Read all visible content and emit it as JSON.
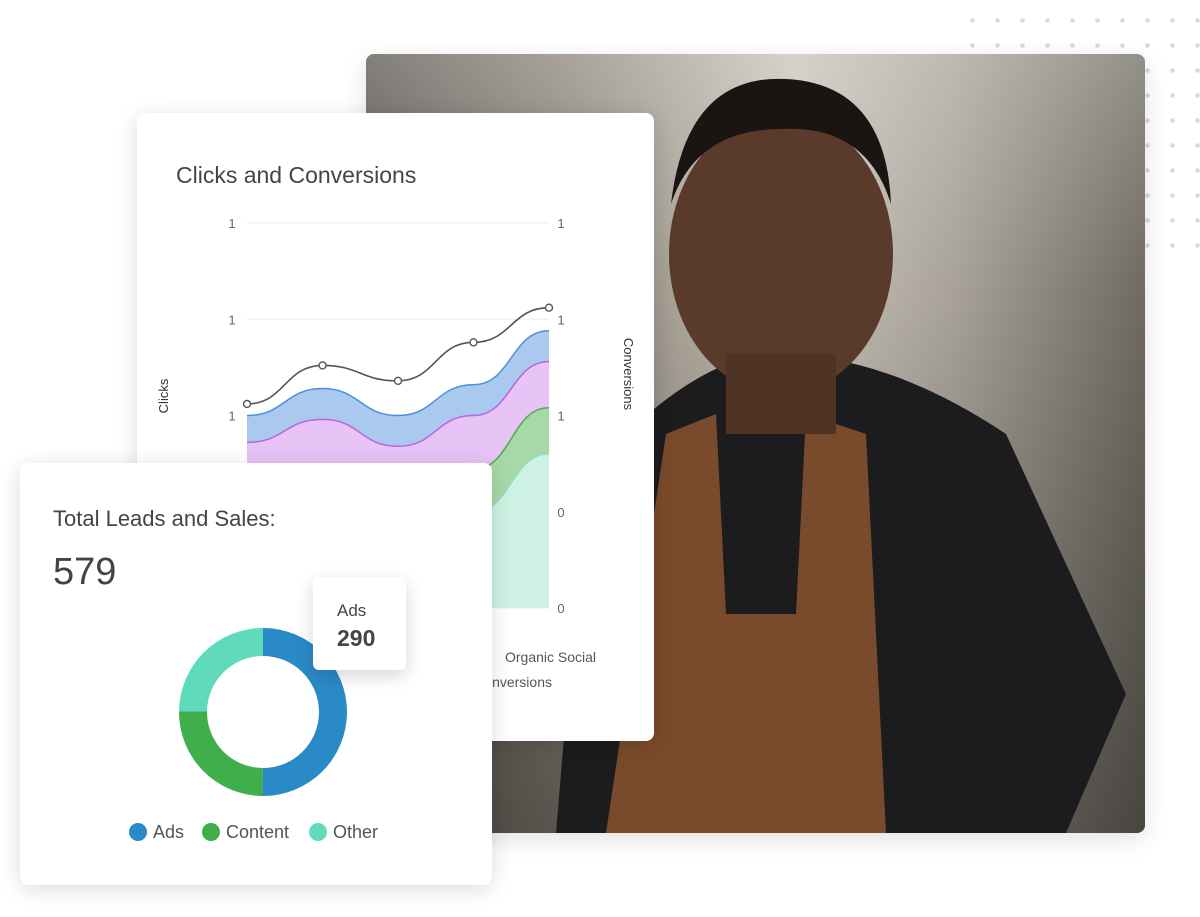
{
  "chart_data": [
    {
      "type": "area",
      "title": "Clicks and Conversions",
      "ylabel": "Clicks",
      "y2label": "Conversions",
      "left_ticks": [
        "1",
        "1",
        "1"
      ],
      "right_ticks": [
        "1",
        "1",
        "1",
        "0",
        "0"
      ],
      "x": [
        0,
        1,
        2,
        3,
        4
      ],
      "grid": true,
      "line": {
        "axis": "left",
        "values": [
          0.53,
          0.63,
          0.59,
          0.69,
          0.78
        ],
        "color": "#555555"
      },
      "series": [
        {
          "values": [
            0.5,
            0.57,
            0.5,
            0.58,
            0.72
          ],
          "color": "#a9c9ee",
          "stroke": "#4a90d9"
        },
        {
          "values": [
            0.43,
            0.49,
            0.42,
            0.5,
            0.64
          ],
          "color": "#e8c3f5",
          "stroke": "#b964e0"
        },
        {
          "name": "Organic Social",
          "values": [
            0.1,
            0.15,
            0.2,
            0.36,
            0.52
          ],
          "color": "#a8d8a8",
          "stroke": "#4caf50"
        },
        {
          "values": [
            0.08,
            0.12,
            0.16,
            0.25,
            0.4
          ],
          "color": "#cdf2e4",
          "stroke": "#8fe0c0"
        }
      ],
      "legend": [
        "Organic Social",
        "Conversions"
      ]
    },
    {
      "type": "pie",
      "title": "Total Leads and Sales:",
      "total": "579",
      "slices": [
        {
          "name": "Ads",
          "value": 290,
          "color": "#2a8ac8"
        },
        {
          "name": "Content",
          "value": 145,
          "color": "#3fae4b"
        },
        {
          "name": "Other",
          "value": 144,
          "color": "#5fdbbb"
        }
      ],
      "tooltip": {
        "label": "Ads",
        "value": "290"
      }
    }
  ]
}
